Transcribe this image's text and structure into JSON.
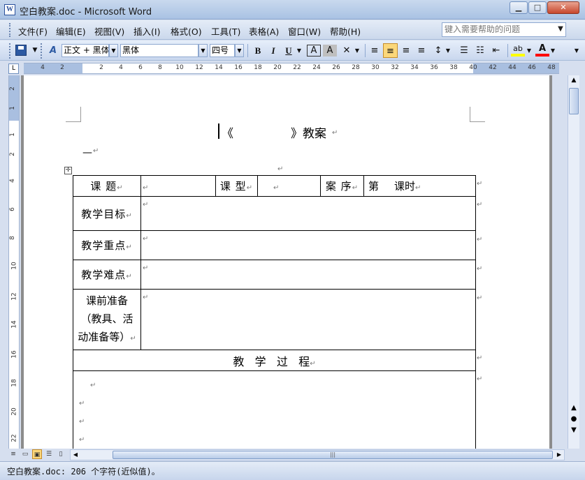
{
  "window": {
    "title": "空白教案.doc - Microsoft Word",
    "app_icon": "W",
    "buttons": {
      "minimize": "▁",
      "maximize": "□",
      "close": "✕"
    }
  },
  "menu": {
    "items": [
      "文件(F)",
      "编辑(E)",
      "视图(V)",
      "插入(I)",
      "格式(O)",
      "工具(T)",
      "表格(A)",
      "窗口(W)",
      "帮助(H)"
    ],
    "help_placeholder": "键入需要帮助的问题"
  },
  "toolbar": {
    "style_value": "正文 + 黑体",
    "font_value": "黑体",
    "size_value": "四号",
    "bold": "B",
    "italic": "I",
    "underline": "U",
    "char_border": "A",
    "char_shading": "A",
    "align_left": "≡",
    "align_center": "≡",
    "align_right": "≡",
    "justify": "≡",
    "highlight": "ab",
    "font_color": "A",
    "colors": {
      "highlight": "#ffff00",
      "font_color": "#ff0000",
      "active": "#fbd77a"
    }
  },
  "ruler": {
    "marks": [
      "4",
      "2",
      "2",
      "4",
      "6",
      "8",
      "10",
      "12",
      "14",
      "16",
      "18",
      "20",
      "22",
      "24",
      "26",
      "28",
      "30",
      "32",
      "34",
      "36",
      "38",
      "40",
      "42",
      "44",
      "46",
      "48"
    ],
    "vmarks": [
      "2",
      "1",
      "1",
      "2",
      "4",
      "6",
      "8",
      "10",
      "12",
      "14",
      "16",
      "18",
      "20",
      "22"
    ]
  },
  "document": {
    "title_open": "《",
    "title_close": "》教案",
    "pilcrow": "↵",
    "dash_line": "—",
    "table": {
      "topic_label": "课 题",
      "type_label": "课 型",
      "order_label": "案 序",
      "period_label_1": "第",
      "period_label_2": "课时",
      "objectives_label": "教学目标",
      "key_points_label": "教学重点",
      "difficulties_label": "教学难点",
      "prep_label_1": "课前准备",
      "prep_label_2": "（教具、活",
      "prep_label_3": "动准备等）",
      "process_label": "教   学   过   程"
    }
  },
  "status": {
    "text": "空白教案.doc: 206 个字符(近似值)。"
  }
}
